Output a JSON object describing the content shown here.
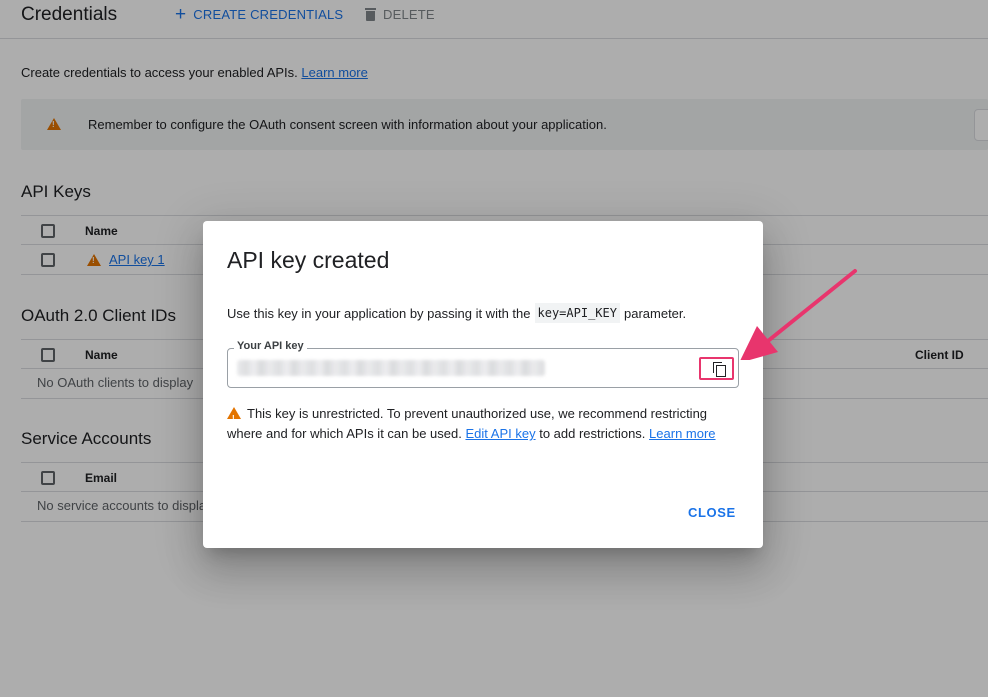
{
  "header": {
    "title": "Credentials",
    "create_label": "CREATE CREDENTIALS",
    "delete_label": "DELETE"
  },
  "intro": {
    "text": "Create credentials to access your enabled APIs.",
    "link": "Learn more"
  },
  "banner": {
    "text": "Remember to configure the OAuth consent screen with information about your application."
  },
  "api_keys": {
    "title": "API Keys",
    "columns": [
      "Name"
    ],
    "rows": [
      {
        "name": "API key 1"
      }
    ]
  },
  "oauth": {
    "title": "OAuth 2.0 Client IDs",
    "columns": [
      "Name",
      "Client ID"
    ],
    "empty": "No OAuth clients to display"
  },
  "service_accounts": {
    "title": "Service Accounts",
    "columns": [
      "Email"
    ],
    "empty": "No service accounts to displa"
  },
  "dialog": {
    "title": "API key created",
    "desc_before": "Use this key in your application by passing it with the",
    "desc_code": "key=API_KEY",
    "desc_after": "parameter.",
    "field_label": "Your API key",
    "warning_text_1": "This key is unrestricted. To prevent unauthorized use, we recommend restricting where and for which APIs it can be used.",
    "warning_link_1": "Edit API key",
    "warning_text_2": "to add restrictions.",
    "warning_link_2": "Learn more",
    "close_label": "CLOSE"
  },
  "colors": {
    "accent": "#1a73e8",
    "warning": "#e37400",
    "highlight": "#e8356d"
  },
  "icons": [
    "plus-icon",
    "trash-icon",
    "warning-icon",
    "copy-icon",
    "arrow-annotation"
  ]
}
